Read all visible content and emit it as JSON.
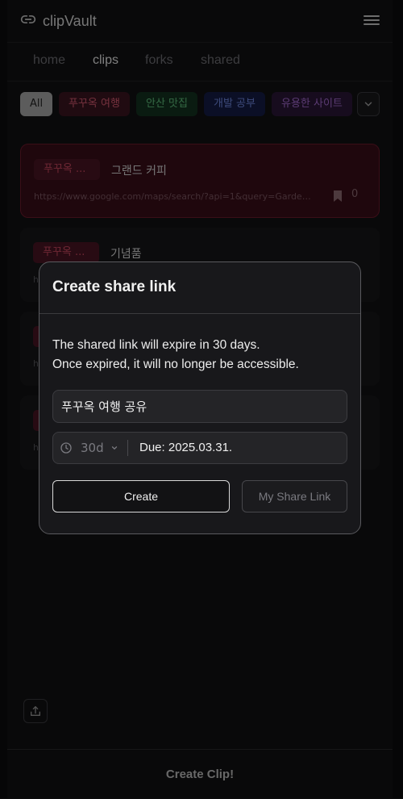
{
  "app": {
    "title": "clipVault"
  },
  "tabs": [
    {
      "label": "home"
    },
    {
      "label": "clips"
    },
    {
      "label": "forks"
    },
    {
      "label": "shared"
    }
  ],
  "filters": [
    {
      "label": "All"
    },
    {
      "label": "푸꾸옥 여행"
    },
    {
      "label": "안산 맛집"
    },
    {
      "label": "개발 공부"
    },
    {
      "label": "유용한 사이트"
    }
  ],
  "clips": [
    {
      "tag": "푸꾸옥 ...",
      "name": "그랜드 커피",
      "url": "https://www.google.com/maps/search/?api=1&query=Garden...",
      "count": "0"
    },
    {
      "tag": "푸꾸옥 ...",
      "name": "기념품",
      "url": "h"
    },
    {
      "url": "h"
    },
    {
      "url": "h"
    }
  ],
  "footer": {
    "create_label": "Create Clip!"
  },
  "modal": {
    "title": "Create share link",
    "desc_line1": "The shared link will expire in 30 days.",
    "desc_line2": "Once expired, it will no longer be accessible.",
    "name_value": "푸꾸옥 여행 공유",
    "period_value": "30d",
    "due_text": "Due: 2025.03.31.",
    "create_label": "Create",
    "my_link_label": "My Share Link"
  },
  "colors": {
    "background": "#111113",
    "highlight_card": "#3a0d18",
    "accent_red": "#c9485f",
    "accent_green": "#5fbf7d",
    "accent_blue": "#6f87e0",
    "accent_purple": "#a56ad0"
  },
  "icons": {
    "brand": "link-icon",
    "menu": "hamburger-menu-icon",
    "more_filters": "chevron-down-icon",
    "bookmark": "bookmark-icon",
    "share": "share-upload-icon",
    "period": "clock-icon"
  }
}
